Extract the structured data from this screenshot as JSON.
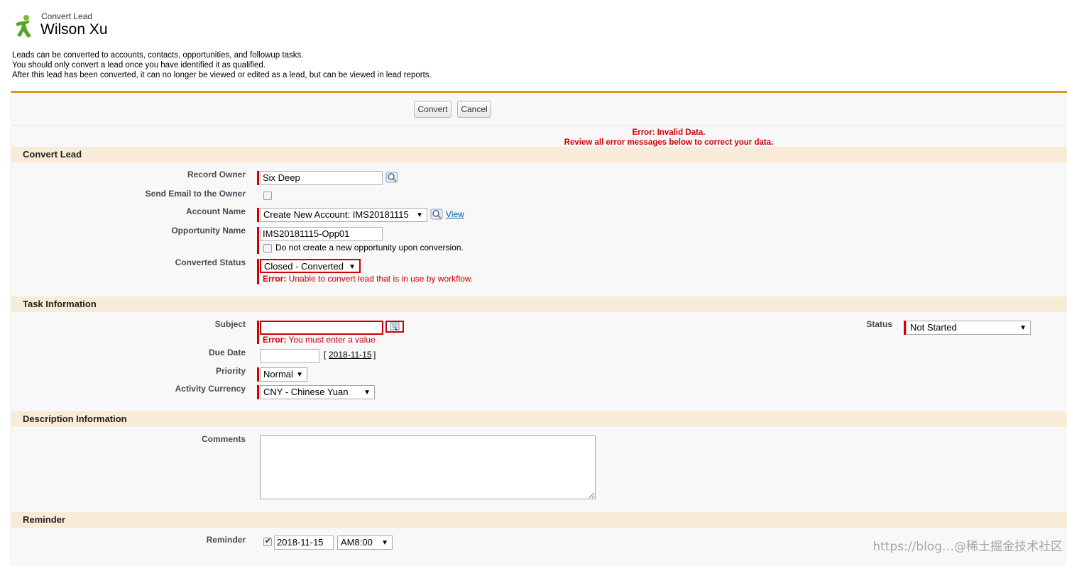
{
  "header": {
    "subtitle": "Convert Lead",
    "name": "Wilson Xu"
  },
  "intro": {
    "line1": "Leads can be converted to accounts, contacts, opportunities, and followup tasks.",
    "line2": "You should only convert a lead once you have identified it as qualified.",
    "line3": "After this lead has been converted, it can no longer be viewed or edited as a lead, but can be viewed in lead reports."
  },
  "toolbar": {
    "convert_label": "Convert",
    "cancel_label": "Cancel"
  },
  "error_summary": {
    "line1": "Error: Invalid Data.",
    "line2": "Review all error messages below to correct your data."
  },
  "sections": {
    "convert_lead": "Convert Lead",
    "task_info": "Task Information",
    "description_info": "Description Information",
    "reminder": "Reminder"
  },
  "convert": {
    "record_owner_label": "Record Owner",
    "record_owner_value": "Six Deep",
    "send_email_label": "Send Email to the Owner",
    "send_email_checked": false,
    "account_name_label": "Account Name",
    "account_name_value": "Create New Account: IMS20181115",
    "account_view_link": "View",
    "opportunity_name_label": "Opportunity Name",
    "opportunity_name_value": "IMS20181115-Opp01",
    "no_opportunity_label": "Do not create a new opportunity upon conversion.",
    "no_opportunity_checked": false,
    "converted_status_label": "Converted Status",
    "converted_status_value": "Closed - Converted",
    "converted_status_error_prefix": "Error:",
    "converted_status_error": " Unable to convert lead that is in use by workflow."
  },
  "task": {
    "subject_label": "Subject",
    "subject_value": "",
    "subject_error_prefix": "Error:",
    "subject_error": " You must enter a value",
    "status_label": "Status",
    "status_value": "Not Started",
    "due_date_label": "Due Date",
    "due_date_value": "",
    "due_date_link": "2018-11-15",
    "bracket_open": "[",
    "bracket_close": "]",
    "priority_label": "Priority",
    "priority_value": "Normal",
    "currency_label": "Activity Currency",
    "currency_value": "CNY - Chinese Yuan"
  },
  "description": {
    "comments_label": "Comments",
    "comments_value": ""
  },
  "reminder": {
    "reminder_label": "Reminder",
    "reminder_checked": true,
    "date_value": "2018-11-15",
    "time_value": "AM8:00"
  },
  "watermark": "https://blog…@稀土掘金技术社区",
  "colors": {
    "accent_orange": "#e39321",
    "error_red": "#cc0000",
    "section_bg": "#f8ebd7",
    "link_blue": "#015ba7"
  },
  "icons": {
    "lead": "lead-person-icon",
    "lookup": "magnifier-lookup-icon",
    "dropdown": "dropdown-arrow-icon"
  }
}
